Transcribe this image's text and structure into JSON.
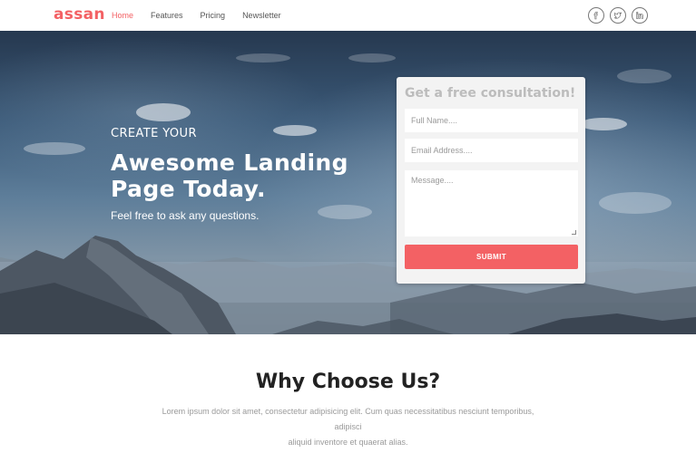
{
  "brand": {
    "name": "assan",
    "accent_color": "#f36164"
  },
  "nav": {
    "items": [
      {
        "label": "Home",
        "active": true
      },
      {
        "label": "Features",
        "active": false
      },
      {
        "label": "Pricing",
        "active": false
      },
      {
        "label": "Newsletter",
        "active": false
      }
    ],
    "social": [
      {
        "icon": "facebook-icon"
      },
      {
        "icon": "twitter-icon"
      },
      {
        "icon": "linkedin-icon"
      }
    ]
  },
  "hero": {
    "kicker": "CREATE YOUR",
    "title_line1": "Awesome Landing",
    "title_line2": "Page Today.",
    "subtitle": "Feel free to ask any questions."
  },
  "form": {
    "title": "Get a free consultation!",
    "name_placeholder": "Full Name....",
    "email_placeholder": "Email Address....",
    "message_placeholder": "Message....",
    "submit_label": "SUBMIT"
  },
  "why": {
    "title": "Why Choose Us?",
    "text_line1": "Lorem ipsum dolor sit amet, consectetur adipisicing elit. Cum quas necessitatibus nesciunt temporibus, adipisci",
    "text_line2": "aliquid inventore et quaerat alias."
  }
}
